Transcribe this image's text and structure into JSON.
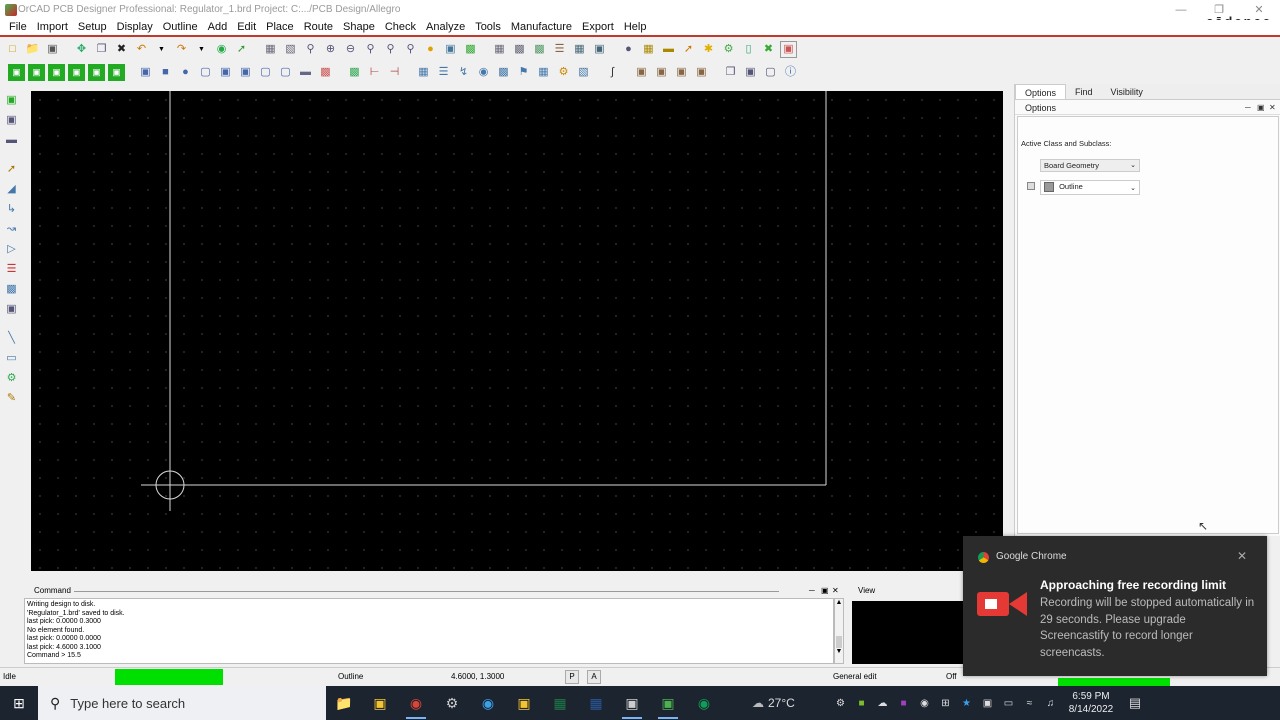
{
  "window": {
    "title": "OrCAD PCB Designer Professional: Regulator_1.brd  Project: C:.../PCB Design/Allegro",
    "brand": "cādence"
  },
  "menu": [
    "File",
    "Import",
    "Setup",
    "Display",
    "Outline",
    "Add",
    "Edit",
    "Place",
    "Route",
    "Shape",
    "Check",
    "Analyze",
    "Tools",
    "Manufacture",
    "Export",
    "Help"
  ],
  "options_panel": {
    "tabs": [
      "Options",
      "Find",
      "Visibility"
    ],
    "header": "Options",
    "active_label": "Active Class and Subclass:",
    "class_value": "Board Geometry",
    "subclass_value": "Outline"
  },
  "command": {
    "title": "Command",
    "lines": [
      "Writing design to disk.",
      "'Regulator_1.brd' saved to disk.",
      "last pick:  0.0000 0.3000",
      "No element found.",
      "last pick:  0.0000 0.0000",
      "last pick:  4.6000 3.1000",
      "Command > 15.5"
    ]
  },
  "view": {
    "title": "View"
  },
  "status": {
    "state": "Idle",
    "subclass": "Outline",
    "coords": "4.6000, 1.3000",
    "p_btn": "P",
    "a_btn": "A",
    "mode": "General edit",
    "off": "Off",
    "indicator_color": "#00e000"
  },
  "notification": {
    "app": "Google Chrome",
    "heading": "Approaching free recording limit",
    "body": "Recording will be stopped automatically in 29 seconds. Please upgrade Screencastify to record longer screencasts.",
    "accent": "#e53935"
  },
  "taskbar": {
    "search_placeholder": "Type here to search",
    "weather": "27°C",
    "time": "6:59 PM",
    "date": "8/14/2022"
  },
  "colors": {
    "canvas_bg": "#000000",
    "outline": "#d8d8d8",
    "menu_underline": "#c0392b",
    "taskbar_bg": "#1c2430"
  }
}
